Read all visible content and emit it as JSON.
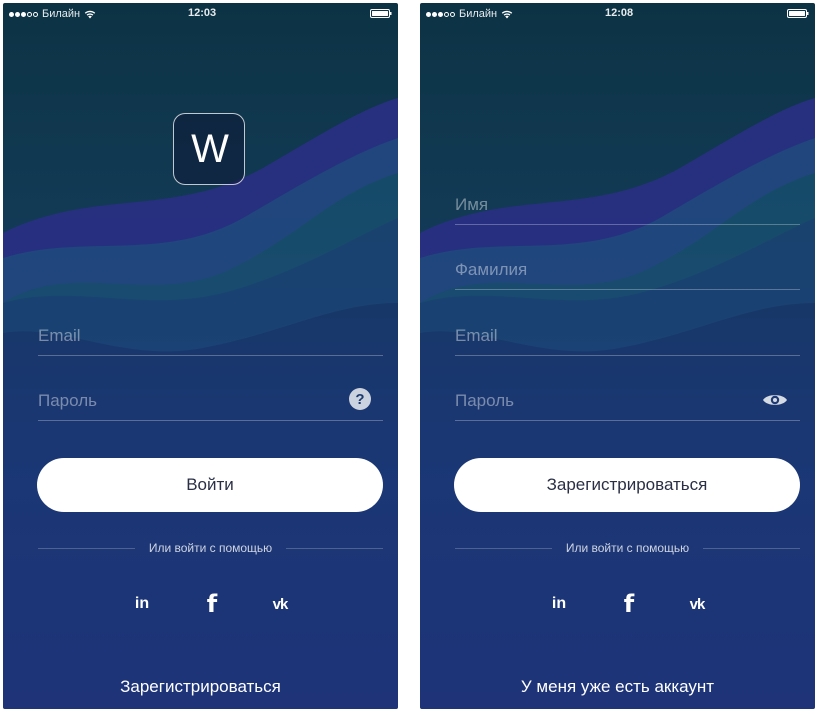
{
  "left_screen": {
    "status": {
      "carrier": "Билайн",
      "time": "12:03"
    },
    "logo_letter": "W",
    "fields": {
      "email_placeholder": "Email",
      "password_placeholder": "Пароль"
    },
    "help_icon_glyph": "?",
    "primary_button_label": "Войти",
    "divider_text": "Или войти с помощью",
    "social": {
      "linkedin": "in",
      "facebook": "f",
      "vk": "vk"
    },
    "bottom_link": "Зарегистрироваться"
  },
  "right_screen": {
    "status": {
      "carrier": "Билайн",
      "time": "12:08"
    },
    "fields": {
      "first_name_placeholder": "Имя",
      "last_name_placeholder": "Фамилия",
      "email_placeholder": "Email",
      "password_placeholder": "Пароль"
    },
    "primary_button_label": "Зарегистрироваться",
    "divider_text": "Или войти с помощью",
    "social": {
      "linkedin": "in",
      "facebook": "f",
      "vk": "vk"
    },
    "bottom_link": "У меня уже есть аккаунт"
  },
  "icons": {
    "signal": "signal-dots-icon",
    "wifi": "wifi-icon",
    "battery": "battery-icon",
    "help": "question-circle-icon",
    "eye": "eye-icon"
  },
  "colors": {
    "button_background": "#ffffff",
    "button_text": "#2a2f45",
    "background_top": "#0c3344",
    "background_bottom": "#1f3479",
    "wave_purple": "#2b2f87",
    "wave_teal": "#1b5a7c"
  }
}
